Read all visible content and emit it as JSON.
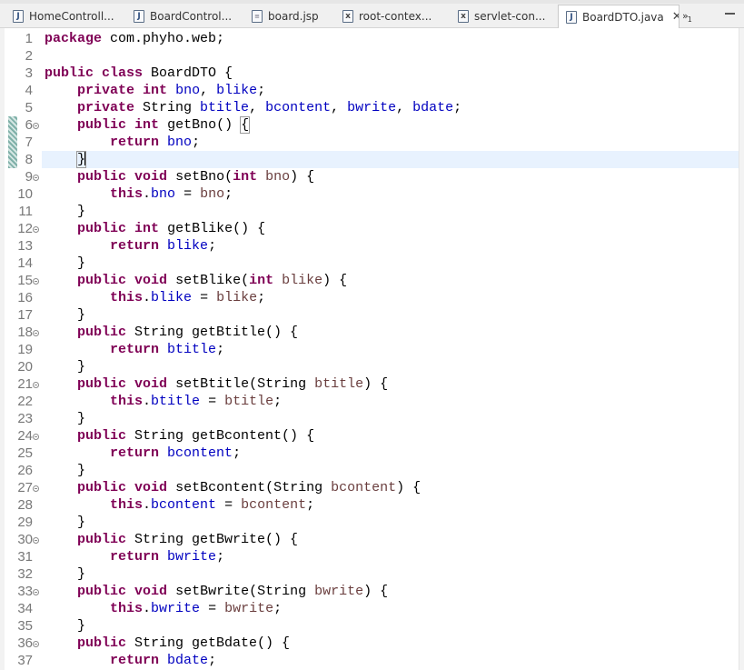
{
  "tabs": [
    {
      "label": "HomeControll...",
      "icon": "java-file-icon",
      "active": false
    },
    {
      "label": "BoardControl...",
      "icon": "java-file-icon",
      "active": false
    },
    {
      "label": "board.jsp",
      "icon": "jsp-file-icon",
      "active": false
    },
    {
      "label": "root-contex...",
      "icon": "xml-file-icon",
      "active": false
    },
    {
      "label": "servlet-con...",
      "icon": "xml-file-icon",
      "active": false
    },
    {
      "label": "BoardDTO.java",
      "icon": "java-file-icon",
      "active": true
    }
  ],
  "tab_overflow": {
    "symbol": "»",
    "count": "1"
  },
  "editor": {
    "current_line": 8,
    "colors": {
      "keyword": "#7f0055",
      "field": "#0000c0",
      "parameter": "#6a3e3e",
      "line_highlight": "#e8f2fe"
    },
    "lines": [
      {
        "n": "1",
        "fold": false,
        "code": [
          [
            "kw",
            "package"
          ],
          [
            "t",
            " com.phyho.web;"
          ]
        ]
      },
      {
        "n": "2",
        "fold": false,
        "code": []
      },
      {
        "n": "3",
        "fold": false,
        "code": [
          [
            "kw",
            "public"
          ],
          [
            "t",
            " "
          ],
          [
            "kw",
            "class"
          ],
          [
            "t",
            " BoardDTO {"
          ]
        ]
      },
      {
        "n": "4",
        "fold": false,
        "code": [
          [
            "t",
            "    "
          ],
          [
            "kw",
            "private"
          ],
          [
            "t",
            " "
          ],
          [
            "kw",
            "int"
          ],
          [
            "t",
            " "
          ],
          [
            "fld",
            "bno"
          ],
          [
            "t",
            ", "
          ],
          [
            "fld",
            "blike"
          ],
          [
            "t",
            ";"
          ]
        ]
      },
      {
        "n": "5",
        "fold": false,
        "code": [
          [
            "t",
            "    "
          ],
          [
            "kw",
            "private"
          ],
          [
            "t",
            " String "
          ],
          [
            "fld",
            "btitle"
          ],
          [
            "t",
            ", "
          ],
          [
            "fld",
            "bcontent"
          ],
          [
            "t",
            ", "
          ],
          [
            "fld",
            "bwrite"
          ],
          [
            "t",
            ", "
          ],
          [
            "fld",
            "bdate"
          ],
          [
            "t",
            ";"
          ]
        ]
      },
      {
        "n": "6",
        "fold": true,
        "code": [
          [
            "t",
            "    "
          ],
          [
            "kw",
            "public"
          ],
          [
            "t",
            " "
          ],
          [
            "kw",
            "int"
          ],
          [
            "t",
            " getBno() "
          ],
          [
            "br",
            "{"
          ]
        ]
      },
      {
        "n": "7",
        "fold": false,
        "code": [
          [
            "t",
            "        "
          ],
          [
            "kw",
            "return"
          ],
          [
            "t",
            " "
          ],
          [
            "fld",
            "bno"
          ],
          [
            "t",
            ";"
          ]
        ]
      },
      {
        "n": "8",
        "fold": false,
        "code": [
          [
            "t",
            "    "
          ],
          [
            "br",
            "}"
          ],
          [
            "caret",
            ""
          ]
        ]
      },
      {
        "n": "9",
        "fold": true,
        "code": [
          [
            "t",
            "    "
          ],
          [
            "kw",
            "public"
          ],
          [
            "t",
            " "
          ],
          [
            "kw",
            "void"
          ],
          [
            "t",
            " setBno("
          ],
          [
            "kw",
            "int"
          ],
          [
            "t",
            " "
          ],
          [
            "par",
            "bno"
          ],
          [
            "t",
            ") {"
          ]
        ]
      },
      {
        "n": "10",
        "fold": false,
        "code": [
          [
            "t",
            "        "
          ],
          [
            "kw",
            "this"
          ],
          [
            "t",
            "."
          ],
          [
            "fld",
            "bno"
          ],
          [
            "t",
            " = "
          ],
          [
            "par",
            "bno"
          ],
          [
            "t",
            ";"
          ]
        ]
      },
      {
        "n": "11",
        "fold": false,
        "code": [
          [
            "t",
            "    }"
          ]
        ]
      },
      {
        "n": "12",
        "fold": true,
        "code": [
          [
            "t",
            "    "
          ],
          [
            "kw",
            "public"
          ],
          [
            "t",
            " "
          ],
          [
            "kw",
            "int"
          ],
          [
            "t",
            " getBlike() {"
          ]
        ]
      },
      {
        "n": "13",
        "fold": false,
        "code": [
          [
            "t",
            "        "
          ],
          [
            "kw",
            "return"
          ],
          [
            "t",
            " "
          ],
          [
            "fld",
            "blike"
          ],
          [
            "t",
            ";"
          ]
        ]
      },
      {
        "n": "14",
        "fold": false,
        "code": [
          [
            "t",
            "    }"
          ]
        ]
      },
      {
        "n": "15",
        "fold": true,
        "code": [
          [
            "t",
            "    "
          ],
          [
            "kw",
            "public"
          ],
          [
            "t",
            " "
          ],
          [
            "kw",
            "void"
          ],
          [
            "t",
            " setBlike("
          ],
          [
            "kw",
            "int"
          ],
          [
            "t",
            " "
          ],
          [
            "par",
            "blike"
          ],
          [
            "t",
            ") {"
          ]
        ]
      },
      {
        "n": "16",
        "fold": false,
        "code": [
          [
            "t",
            "        "
          ],
          [
            "kw",
            "this"
          ],
          [
            "t",
            "."
          ],
          [
            "fld",
            "blike"
          ],
          [
            "t",
            " = "
          ],
          [
            "par",
            "blike"
          ],
          [
            "t",
            ";"
          ]
        ]
      },
      {
        "n": "17",
        "fold": false,
        "code": [
          [
            "t",
            "    }"
          ]
        ]
      },
      {
        "n": "18",
        "fold": true,
        "code": [
          [
            "t",
            "    "
          ],
          [
            "kw",
            "public"
          ],
          [
            "t",
            " String getBtitle() {"
          ]
        ]
      },
      {
        "n": "19",
        "fold": false,
        "code": [
          [
            "t",
            "        "
          ],
          [
            "kw",
            "return"
          ],
          [
            "t",
            " "
          ],
          [
            "fld",
            "btitle"
          ],
          [
            "t",
            ";"
          ]
        ]
      },
      {
        "n": "20",
        "fold": false,
        "code": [
          [
            "t",
            "    }"
          ]
        ]
      },
      {
        "n": "21",
        "fold": true,
        "code": [
          [
            "t",
            "    "
          ],
          [
            "kw",
            "public"
          ],
          [
            "t",
            " "
          ],
          [
            "kw",
            "void"
          ],
          [
            "t",
            " setBtitle(String "
          ],
          [
            "par",
            "btitle"
          ],
          [
            "t",
            ") {"
          ]
        ]
      },
      {
        "n": "22",
        "fold": false,
        "code": [
          [
            "t",
            "        "
          ],
          [
            "kw",
            "this"
          ],
          [
            "t",
            "."
          ],
          [
            "fld",
            "btitle"
          ],
          [
            "t",
            " = "
          ],
          [
            "par",
            "btitle"
          ],
          [
            "t",
            ";"
          ]
        ]
      },
      {
        "n": "23",
        "fold": false,
        "code": [
          [
            "t",
            "    }"
          ]
        ]
      },
      {
        "n": "24",
        "fold": true,
        "code": [
          [
            "t",
            "    "
          ],
          [
            "kw",
            "public"
          ],
          [
            "t",
            " String getBcontent() {"
          ]
        ]
      },
      {
        "n": "25",
        "fold": false,
        "code": [
          [
            "t",
            "        "
          ],
          [
            "kw",
            "return"
          ],
          [
            "t",
            " "
          ],
          [
            "fld",
            "bcontent"
          ],
          [
            "t",
            ";"
          ]
        ]
      },
      {
        "n": "26",
        "fold": false,
        "code": [
          [
            "t",
            "    }"
          ]
        ]
      },
      {
        "n": "27",
        "fold": true,
        "code": [
          [
            "t",
            "    "
          ],
          [
            "kw",
            "public"
          ],
          [
            "t",
            " "
          ],
          [
            "kw",
            "void"
          ],
          [
            "t",
            " setBcontent(String "
          ],
          [
            "par",
            "bcontent"
          ],
          [
            "t",
            ") {"
          ]
        ]
      },
      {
        "n": "28",
        "fold": false,
        "code": [
          [
            "t",
            "        "
          ],
          [
            "kw",
            "this"
          ],
          [
            "t",
            "."
          ],
          [
            "fld",
            "bcontent"
          ],
          [
            "t",
            " = "
          ],
          [
            "par",
            "bcontent"
          ],
          [
            "t",
            ";"
          ]
        ]
      },
      {
        "n": "29",
        "fold": false,
        "code": [
          [
            "t",
            "    }"
          ]
        ]
      },
      {
        "n": "30",
        "fold": true,
        "code": [
          [
            "t",
            "    "
          ],
          [
            "kw",
            "public"
          ],
          [
            "t",
            " String getBwrite() {"
          ]
        ]
      },
      {
        "n": "31",
        "fold": false,
        "code": [
          [
            "t",
            "        "
          ],
          [
            "kw",
            "return"
          ],
          [
            "t",
            " "
          ],
          [
            "fld",
            "bwrite"
          ],
          [
            "t",
            ";"
          ]
        ]
      },
      {
        "n": "32",
        "fold": false,
        "code": [
          [
            "t",
            "    }"
          ]
        ]
      },
      {
        "n": "33",
        "fold": true,
        "code": [
          [
            "t",
            "    "
          ],
          [
            "kw",
            "public"
          ],
          [
            "t",
            " "
          ],
          [
            "kw",
            "void"
          ],
          [
            "t",
            " setBwrite(String "
          ],
          [
            "par",
            "bwrite"
          ],
          [
            "t",
            ") {"
          ]
        ]
      },
      {
        "n": "34",
        "fold": false,
        "code": [
          [
            "t",
            "        "
          ],
          [
            "kw",
            "this"
          ],
          [
            "t",
            "."
          ],
          [
            "fld",
            "bwrite"
          ],
          [
            "t",
            " = "
          ],
          [
            "par",
            "bwrite"
          ],
          [
            "t",
            ";"
          ]
        ]
      },
      {
        "n": "35",
        "fold": false,
        "code": [
          [
            "t",
            "    }"
          ]
        ]
      },
      {
        "n": "36",
        "fold": true,
        "code": [
          [
            "t",
            "    "
          ],
          [
            "kw",
            "public"
          ],
          [
            "t",
            " String getBdate() {"
          ]
        ]
      },
      {
        "n": "37",
        "fold": false,
        "code": [
          [
            "t",
            "        "
          ],
          [
            "kw",
            "return"
          ],
          [
            "t",
            " "
          ],
          [
            "fld",
            "bdate"
          ],
          [
            "t",
            ";"
          ]
        ]
      }
    ]
  }
}
